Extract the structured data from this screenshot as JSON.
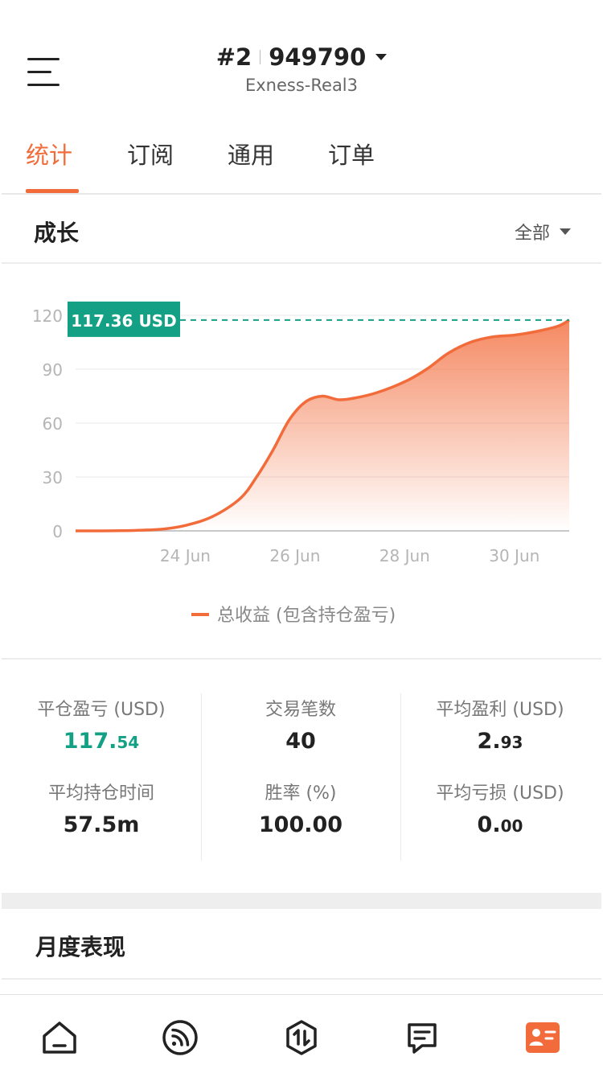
{
  "header": {
    "account_index": "#2",
    "account_number": "949790",
    "server": "Exness-Real3"
  },
  "tabs": [
    {
      "label": "统计",
      "active": true
    },
    {
      "label": "订阅",
      "active": false
    },
    {
      "label": "通用",
      "active": false
    },
    {
      "label": "订单",
      "active": false
    }
  ],
  "growth": {
    "title": "成长",
    "filter_label": "全部"
  },
  "chart_data": {
    "type": "area",
    "title": "",
    "xlabel": "",
    "ylabel": "",
    "x_ticks": [
      "24 Jun",
      "26 Jun",
      "28 Jun",
      "30 Jun"
    ],
    "y_ticks": [
      0,
      30,
      60,
      90,
      120
    ],
    "ylim": [
      0,
      120
    ],
    "xlim": [
      "22 Jun",
      "1 Jul"
    ],
    "grid": true,
    "legend_position": "bottom",
    "current_label": "117.36 USD",
    "current_value": 117.36,
    "series": [
      {
        "name": "总收益 (包含持仓盈亏)",
        "color": "#f26b3a",
        "x": [
          "22 Jun",
          "22.5 Jun",
          "23 Jun",
          "23.3 Jun",
          "23.6 Jun",
          "24 Jun",
          "24.5 Jun",
          "25 Jun",
          "25.3 Jun",
          "25.6 Jun",
          "25.9 Jun",
          "26.2 Jun",
          "26.5 Jun",
          "26.8 Jun",
          "27.1 Jun",
          "27.5 Jun",
          "28 Jun",
          "28.4 Jun",
          "28.8 Jun",
          "29.2 Jun",
          "29.6 Jun",
          "30 Jun",
          "30.4 Jun",
          "30.8 Jun",
          "1 Jul"
        ],
        "x_days": [
          0,
          0.5,
          1,
          1.3,
          1.6,
          2,
          2.5,
          3,
          3.3,
          3.6,
          3.9,
          4.2,
          4.5,
          4.8,
          5.1,
          5.5,
          6,
          6.4,
          6.8,
          7.2,
          7.6,
          8,
          8.4,
          8.8,
          9
        ],
        "values": [
          0,
          0,
          0.2,
          0.5,
          1,
          3,
          8,
          18,
          30,
          45,
          62,
          72,
          75,
          73,
          74,
          77,
          83,
          90,
          99,
          105,
          108,
          109,
          111,
          114,
          117.36
        ]
      }
    ],
    "accent_color": "#14a085"
  },
  "stats": {
    "closed_pnl": {
      "label": "平仓盈亏 (USD)",
      "int": "117.",
      "dec": "54"
    },
    "trade_count": {
      "label": "交易笔数",
      "value": "40"
    },
    "avg_profit": {
      "label": "平均盈利 (USD)",
      "int": "2.",
      "dec": "93"
    },
    "avg_hold_time": {
      "label": "平均持仓时间",
      "value": "57.5m"
    },
    "win_rate": {
      "label": "胜率 (%)",
      "value": "100.00"
    },
    "avg_loss": {
      "label": "平均亏损 (USD)",
      "int": "0.",
      "dec": "00"
    }
  },
  "monthly": {
    "title": "月度表现"
  },
  "bottom_nav": [
    {
      "icon": "home-icon",
      "active": false
    },
    {
      "icon": "feed-icon",
      "active": false
    },
    {
      "icon": "trade-icon",
      "active": false
    },
    {
      "icon": "orders-icon",
      "active": false
    },
    {
      "icon": "account-card-icon",
      "active": true
    }
  ]
}
